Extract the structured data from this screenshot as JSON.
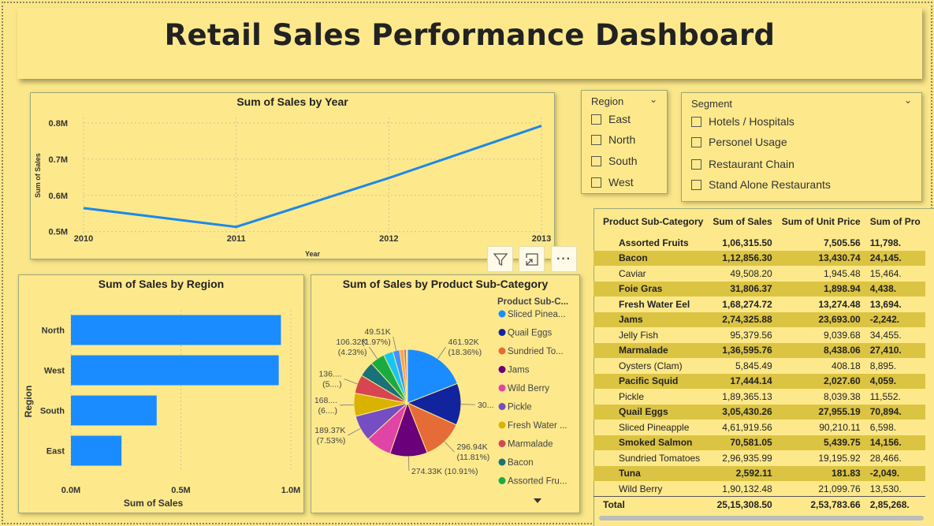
{
  "dashboard": {
    "title": "Retail Sales Performance Dashboard"
  },
  "line_chart_visual": {
    "title": "Sum of Sales by Year",
    "xlabel": "Year",
    "ylabel": "Sum of Sales"
  },
  "region_slicer": {
    "title": "Region",
    "options": [
      "East",
      "North",
      "South",
      "West"
    ]
  },
  "segment_slicer": {
    "title": "Segment",
    "options": [
      "Hotels / Hospitals",
      "Personel Usage",
      "Restaurant Chain",
      "Stand Alone Restaurants"
    ]
  },
  "bar_chart_visual": {
    "title": "Sum of Sales by Region",
    "xlabel": "Sum of Sales",
    "ylabel": "Region"
  },
  "pie_chart_visual": {
    "title": "Sum of Sales by Product Sub-Category",
    "legend_title": "Product Sub-C..."
  },
  "chart_data": [
    {
      "type": "line",
      "title": "Sum of Sales by Year",
      "xlabel": "Year",
      "ylabel": "Sum of Sales",
      "x": [
        "2010",
        "2011",
        "2012",
        "2013"
      ],
      "values": [
        0.565,
        0.513,
        0.648,
        0.792
      ],
      "ylim": [
        0.495,
        0.815
      ],
      "yticks": [
        "0.5M",
        "0.6M",
        "0.7M",
        "0.8M"
      ],
      "ytick_values": [
        0.5,
        0.6,
        0.7,
        0.8
      ],
      "grid": true,
      "color": "#1e88e5"
    },
    {
      "type": "bar",
      "orientation": "horizontal",
      "title": "Sum of Sales by Region",
      "xlabel": "Sum of Sales",
      "ylabel": "Region",
      "categories": [
        "North",
        "West",
        "South",
        "East"
      ],
      "values": [
        0.955,
        0.945,
        0.39,
        0.23
      ],
      "xlim": [
        0,
        1.0
      ],
      "xticks": [
        "0.0M",
        "0.5M",
        "1.0M"
      ],
      "xtick_values": [
        0,
        0.5,
        1.0
      ],
      "color": "#1a8cff"
    },
    {
      "type": "pie",
      "title": "Sum of Sales by Product Sub-Category",
      "legend_title": "Product Sub-C...",
      "slices": [
        {
          "name": "Sliced Pinea...",
          "value": 461.92,
          "color": "#1a8cff"
        },
        {
          "name": "Quail Eggs",
          "value": 305.43,
          "color": "#12239e"
        },
        {
          "name": "Sundried To...",
          "value": 296.94,
          "color": "#e66c37"
        },
        {
          "name": "Jams",
          "value": 274.33,
          "color": "#6b007b"
        },
        {
          "name": "Wild Berry",
          "value": 190.13,
          "color": "#e044a7"
        },
        {
          "name": "Pickle",
          "value": 189.37,
          "color": "#744ec2"
        },
        {
          "name": "Fresh Water ...",
          "value": 168.27,
          "color": "#d9b300"
        },
        {
          "name": "Marmalade",
          "value": 136.6,
          "color": "#d64550"
        },
        {
          "name": "Bacon",
          "value": 112.86,
          "color": "#197278"
        },
        {
          "name": "Assorted Fru...",
          "value": 106.32,
          "color": "#1aab40"
        },
        {
          "name": "Smoked Salmon",
          "value": 70.58,
          "color": "#15c6f4"
        },
        {
          "name": "Caviar",
          "value": 49.51,
          "color": "#4092ff"
        },
        {
          "name": "Foie Gras",
          "value": 31.81,
          "color": "#ffa058"
        },
        {
          "name": "Pacific Squid",
          "value": 17.44,
          "color": "#be5dc9"
        },
        {
          "name": "Oysters (Clam)",
          "value": 5.85,
          "color": "#f472d0"
        },
        {
          "name": "Tuna",
          "value": 2.59,
          "color": "#b5a1ff"
        }
      ],
      "data_labels": [
        {
          "l1": "461.92K",
          "l2": "(18.36%)"
        },
        {
          "l1": "30...",
          "l2": ""
        },
        {
          "l1": "296.94K",
          "l2": "(11.81%)"
        },
        {
          "l1": "274.33K (10.91%)",
          "l2": ""
        },
        {
          "l1": "189.37K",
          "l2": "(7.53%)"
        },
        {
          "l1": "168....",
          "l2": "(6....)"
        },
        {
          "l1": "136....",
          "l2": "(5....)"
        },
        {
          "l1": "106.32K",
          "l2": "(4.23%)"
        },
        {
          "l1": "49.51K",
          "l2": "(1.97%)"
        }
      ]
    },
    {
      "type": "table",
      "columns": [
        "Product Sub-Category",
        "Sum of Sales",
        "Sum of Unit Price",
        "Sum of Pro"
      ],
      "rows": [
        [
          "Assorted Fruits",
          "1,06,315.50",
          "7,505.56",
          "11,798."
        ],
        [
          "Bacon",
          "1,12,856.30",
          "13,430.74",
          "24,145."
        ],
        [
          "Caviar",
          "49,508.20",
          "1,945.48",
          "15,464."
        ],
        [
          "Foie Gras",
          "31,806.37",
          "1,898.94",
          "4,438."
        ],
        [
          "Fresh Water Eel",
          "1,68,274.72",
          "13,274.48",
          "13,694."
        ],
        [
          "Jams",
          "2,74,325.88",
          "23,693.00",
          "-2,242."
        ],
        [
          "Jelly Fish",
          "95,379.56",
          "9,039.68",
          "34,455."
        ],
        [
          "Marmalade",
          "1,36,595.76",
          "8,438.06",
          "27,410."
        ],
        [
          "Oysters (Clam)",
          "5,845.49",
          "408.18",
          "8,895."
        ],
        [
          "Pacific Squid",
          "17,444.14",
          "2,027.60",
          "4,059."
        ],
        [
          "Pickle",
          "1,89,365.13",
          "8,039.38",
          "11,552."
        ],
        [
          "Quail Eggs",
          "3,05,430.26",
          "27,955.19",
          "70,894."
        ],
        [
          "Sliced Pineapple",
          "4,61,919.56",
          "90,210.11",
          "6,598."
        ],
        [
          "Smoked Salmon",
          "70,581.05",
          "5,439.75",
          "14,156."
        ],
        [
          "Sundried Tomatoes",
          "2,96,935.99",
          "19,195.92",
          "28,466."
        ],
        [
          "Tuna",
          "2,592.11",
          "181.83",
          "-2,049."
        ],
        [
          "Wild Berry",
          "1,90,132.48",
          "21,099.76",
          "13,530."
        ]
      ],
      "total": [
        "Total",
        "25,15,308.50",
        "2,53,783.66",
        "2,85,268."
      ]
    }
  ],
  "colors": {
    "background": "#fbe78a",
    "card": "#fde98c",
    "band": "#dcc443",
    "accent": "#1a8cff"
  },
  "toolbar": {
    "icons": [
      "filter-icon",
      "focus-mode-icon",
      "more-options-icon"
    ],
    "more_label": "···"
  }
}
